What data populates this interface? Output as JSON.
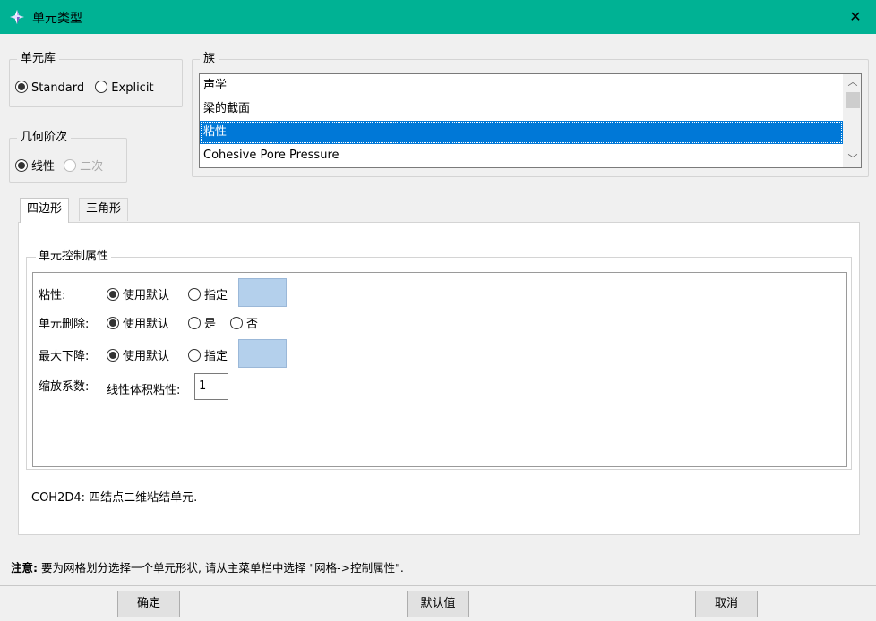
{
  "window": {
    "title": "单元类型",
    "close": "✕",
    "title_bar_color": "#00b294"
  },
  "element_library": {
    "legend": "单元库",
    "options": [
      "Standard",
      "Explicit"
    ],
    "selected": "Standard"
  },
  "geometric_order": {
    "legend": "几何阶次",
    "options": [
      "线性",
      "二次"
    ],
    "selected": "线性"
  },
  "family": {
    "legend": "族",
    "items": [
      "声学",
      "梁的截面",
      "粘性",
      "Cohesive Pore Pressure"
    ],
    "selected": "粘性"
  },
  "tabs": [
    "四边形",
    "三角形"
  ],
  "active_tab": "四边形",
  "element_controls": {
    "legend": "单元控制属性",
    "viscosity": {
      "label": "粘性:",
      "options": [
        "使用默认",
        "指定"
      ],
      "selected": "使用默认"
    },
    "element_deletion": {
      "label": "单元删除:",
      "options": [
        "使用默认",
        "是",
        "否"
      ],
      "selected": "使用默认"
    },
    "max_degradation": {
      "label": "最大下降:",
      "options": [
        "使用默认",
        "指定"
      ],
      "selected": "使用默认"
    },
    "scaling": {
      "label": "缩放系数:",
      "sublabel": "线性体积粘性:",
      "value": "1"
    },
    "field_color": "#b4d0ec"
  },
  "description": "COH2D4: 四结点二维粘结单元.",
  "note": {
    "prefix": "注意:",
    "text": " 要为网格划分选择一个单元形状, 请从主菜单栏中选择 \"网格->控制属性\"."
  },
  "buttons": {
    "ok": "确定",
    "defaults": "默认值",
    "cancel": "取消"
  },
  "selection_color": "#0078d7"
}
